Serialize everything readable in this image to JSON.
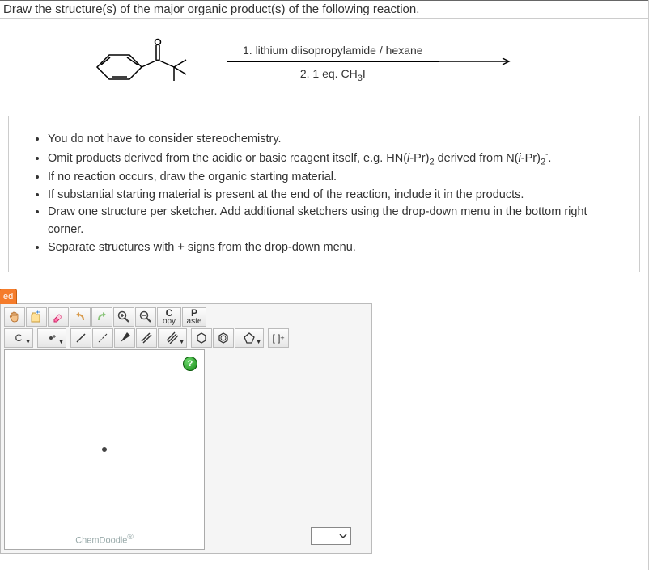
{
  "question": "Draw the structure(s) of the major organic product(s) of the following reaction.",
  "reaction": {
    "condition1": "1. lithium diisopropylamide / hexane",
    "condition2_pre": "2. 1 eq. CH",
    "condition2_sub": "3",
    "condition2_post": "I"
  },
  "instructions": [
    {
      "text": "You do not have to consider stereochemistry."
    },
    {
      "html": "Omit products derived from the acidic or basic reagent itself, e.g. HN(<span class='italic'>i</span>-Pr)<sub>2</sub> derived from N(<span class='italic'>i</span>-Pr)<sub>2</sub><sup>-</sup>."
    },
    {
      "text": "If no reaction occurs, draw the organic starting material."
    },
    {
      "text": "If substantial starting material is present at the end of the reaction, include it in the products."
    },
    {
      "text": "Draw one structure per sketcher. Add additional sketchers using the drop-down menu in the bottom right corner."
    },
    {
      "text": "Separate structures with + signs from the drop-down menu."
    }
  ],
  "tab": "ed",
  "toolbar": {
    "copy_top": "C",
    "copy_bot": "opy",
    "paste_top": "P",
    "paste_bot": "aste",
    "element": "C",
    "charge_label": "[ ]",
    "charge_sup": "±"
  },
  "help": "?",
  "footer": "ChemDoodle",
  "footer_reg": "®"
}
